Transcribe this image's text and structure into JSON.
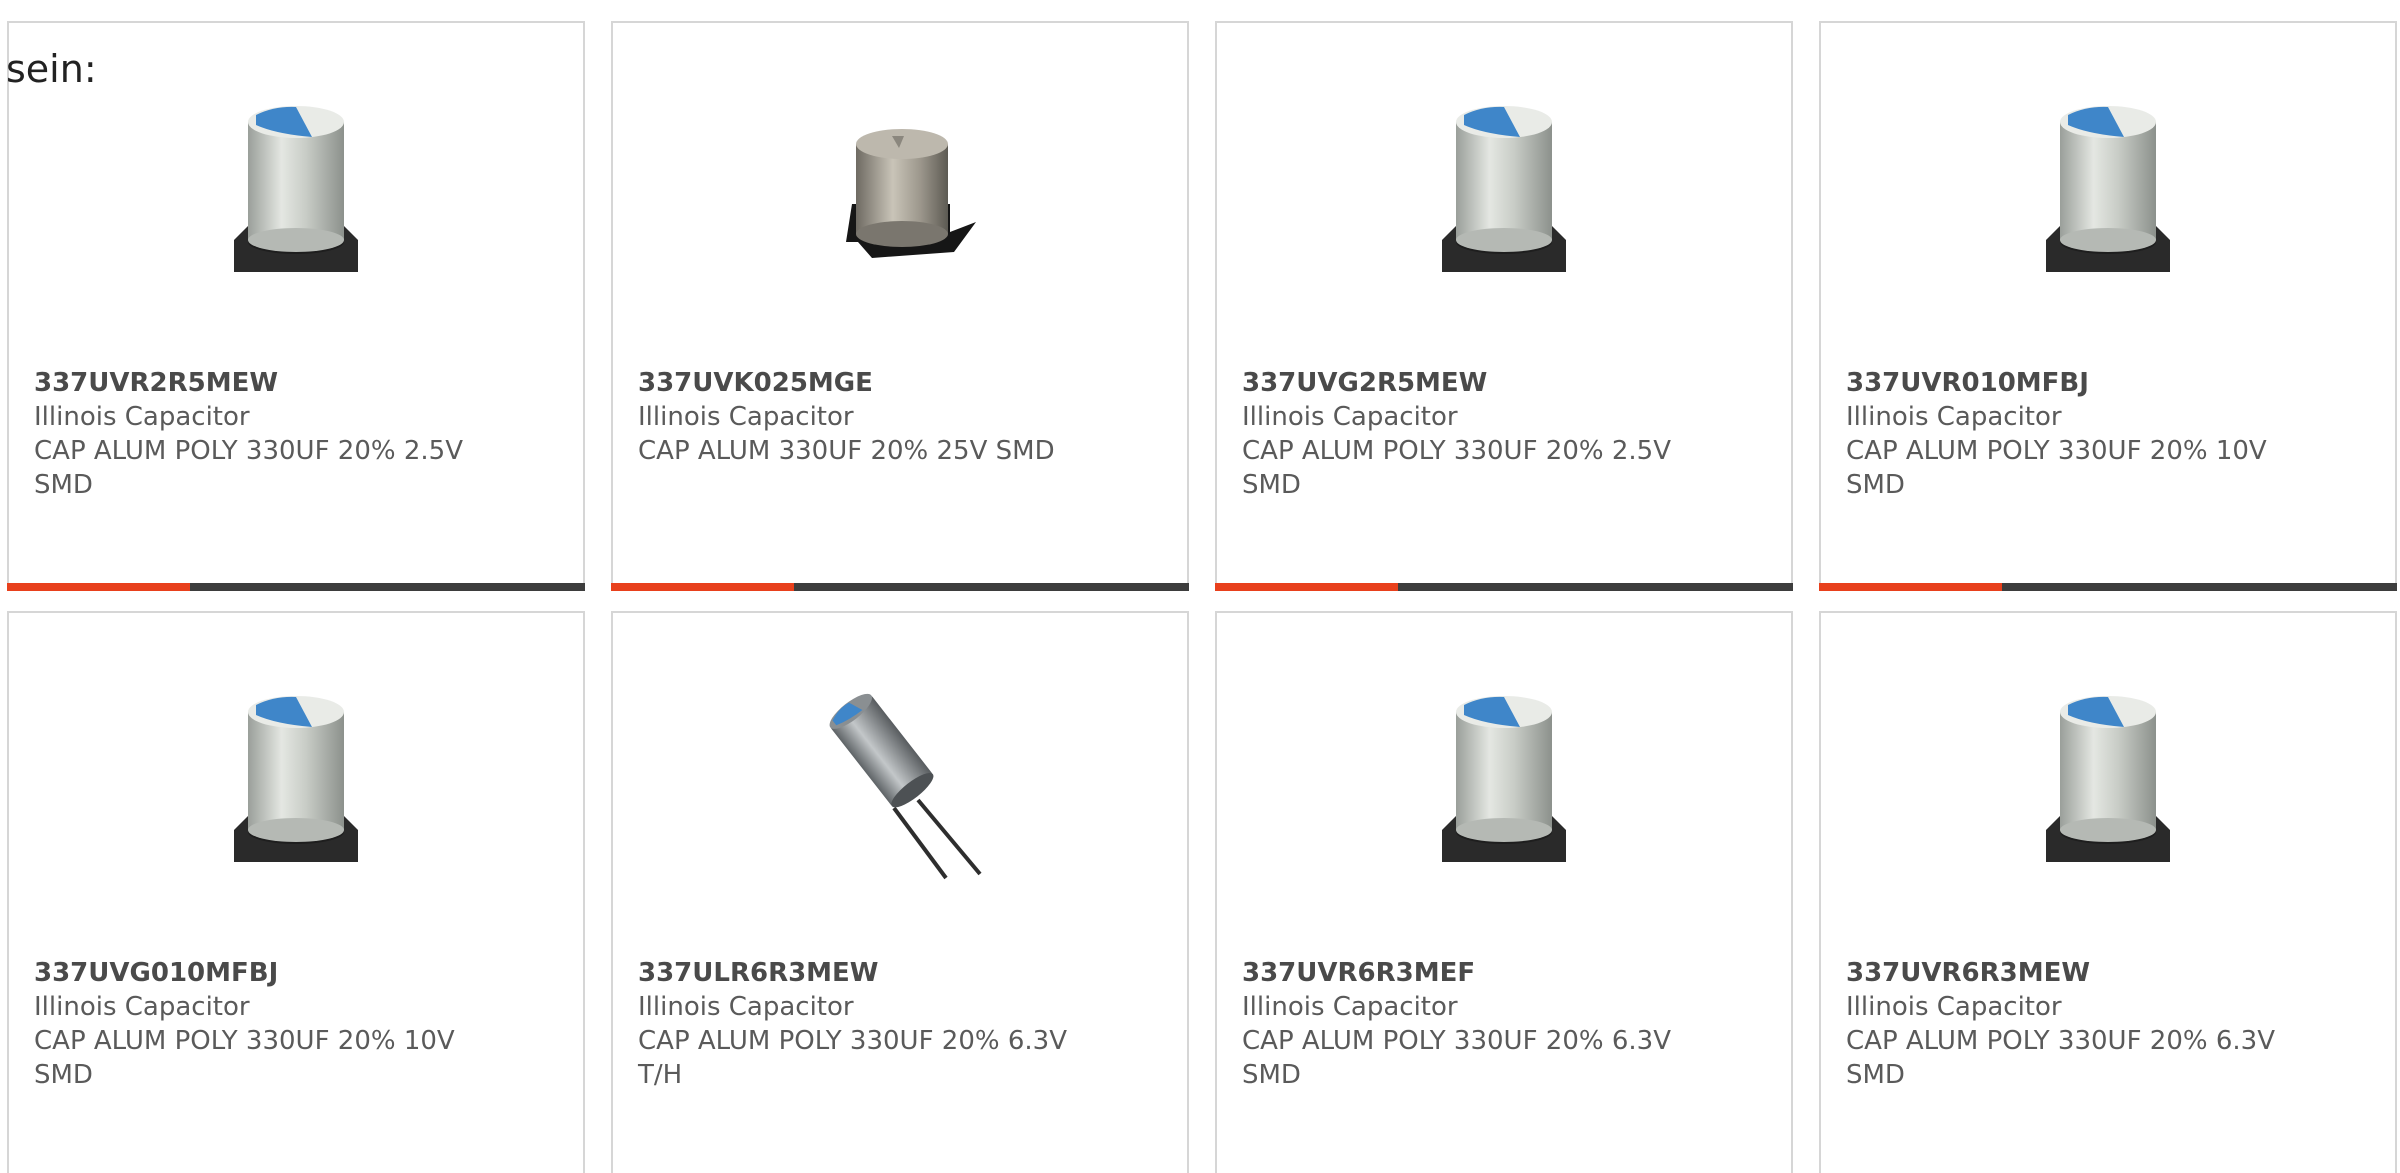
{
  "intro_text": "sein:",
  "colors": {
    "accent": "#e8401c",
    "bar_dark": "#3d3d3d",
    "card_border": "#d6d6d6"
  },
  "products": [
    {
      "part_number": "337UVR2R5MEW",
      "manufacturer": "Illinois Capacitor",
      "description": "CAP ALUM POLY 330UF 20% 2.5V SMD",
      "image_icon": "smd-capacitor-icon"
    },
    {
      "part_number": "337UVK025MGE",
      "manufacturer": "Illinois Capacitor",
      "description": "CAP ALUM 330UF 20% 25V SMD",
      "image_icon": "smd-capacitor-dark-icon"
    },
    {
      "part_number": "337UVG2R5MEW",
      "manufacturer": "Illinois Capacitor",
      "description": "CAP ALUM POLY 330UF 20% 2.5V SMD",
      "image_icon": "smd-capacitor-icon"
    },
    {
      "part_number": "337UVR010MFBJ",
      "manufacturer": "Illinois Capacitor",
      "description": "CAP ALUM POLY 330UF 20% 10V SMD",
      "image_icon": "smd-capacitor-icon"
    },
    {
      "part_number": "337UVG010MFBJ",
      "manufacturer": "Illinois Capacitor",
      "description": "CAP ALUM POLY 330UF 20% 10V SMD",
      "image_icon": "smd-capacitor-icon"
    },
    {
      "part_number": "337ULR6R3MEW",
      "manufacturer": "Illinois Capacitor",
      "description": "CAP ALUM POLY 330UF 20% 6.3V T/H",
      "image_icon": "radial-capacitor-icon"
    },
    {
      "part_number": "337UVR6R3MEF",
      "manufacturer": "Illinois Capacitor",
      "description": "CAP ALUM POLY 330UF 20% 6.3V SMD",
      "image_icon": "smd-capacitor-icon"
    },
    {
      "part_number": "337UVR6R3MEW",
      "manufacturer": "Illinois Capacitor",
      "description": "CAP ALUM POLY 330UF 20% 6.3V SMD",
      "image_icon": "smd-capacitor-icon"
    }
  ]
}
